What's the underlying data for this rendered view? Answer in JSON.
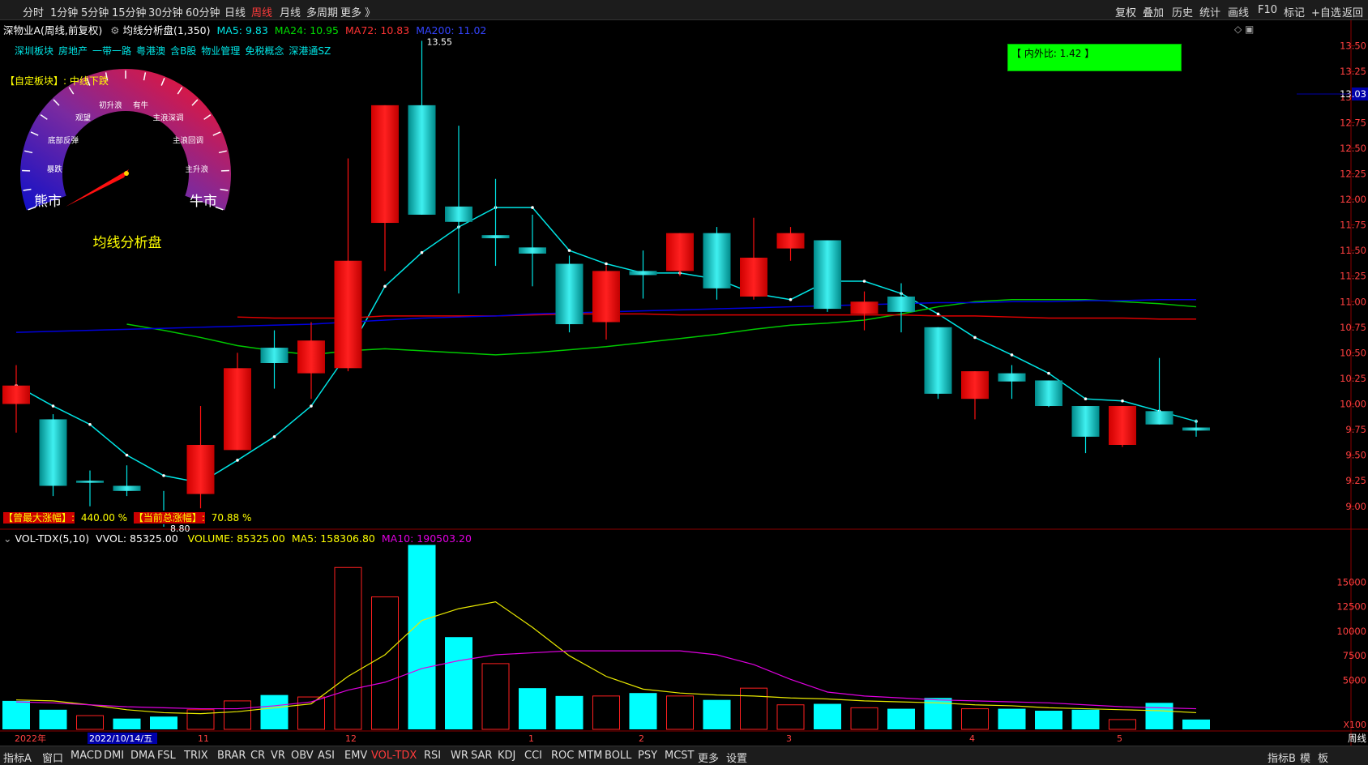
{
  "periods": [
    "分时",
    "1分钟",
    "5分钟",
    "15分钟",
    "30分钟",
    "60分钟",
    "日线",
    "周线",
    "月线",
    "多周期",
    "更多 》"
  ],
  "active_period": "周线",
  "tools": [
    "复权",
    "叠加",
    "历史",
    "统计",
    "画线",
    "F10",
    "标记",
    "+自选",
    "返回"
  ],
  "header": {
    "stock": "深物业A(周线,前复权)",
    "indicator": "均线分析盘(1,350)",
    "ma5": "MA5: 9.83",
    "ma24": "MA24: 10.95",
    "ma72": "MA72: 10.83",
    "ma200": "MA200: 11.02"
  },
  "sectors": [
    "深圳板块",
    "房地产",
    "一带一路",
    "粤港澳",
    "含B股",
    "物业管理",
    "免税概念",
    "深港通SZ"
  ],
  "custom_block": "【自定板块】: 中线下跌",
  "gauge": {
    "title": "均线分析盘",
    "labels": [
      "熊市",
      "暴跌",
      "底部反弹",
      "观望",
      "初升浪",
      "有牛",
      "主浪深调",
      "主浪回调",
      "主升浪",
      "牛市"
    ]
  },
  "inner_outer": "【 内外比: 1.42 】",
  "max_label": "13.55",
  "min_label": "8.80",
  "bottom_info": {
    "max_rise_label": "【曾最大涨幅】:",
    "max_rise_value": "440.00 %",
    "total_rise_label": "【当前总涨幅】:",
    "total_rise_value": "70.88 %"
  },
  "current_price": "13.03",
  "vol_header": {
    "name": "VOL-TDX(5,10)",
    "vvol": "VVOL: 85325.00",
    "volume": "VOLUME: 85325.00",
    "ma5": "MA5: 158306.80",
    "ma10": "MA10: 190503.20"
  },
  "price_axis": [
    "13.50",
    "13.25",
    "13.00",
    "12.75",
    "12.50",
    "12.25",
    "12.00",
    "11.75",
    "11.50",
    "11.25",
    "11.00",
    "10.75",
    "10.50",
    "10.25",
    "10.00",
    "9.75",
    "9.50",
    "9.25",
    "9.00"
  ],
  "vol_axis": [
    "15000",
    "12500",
    "10000",
    "7500",
    "5000"
  ],
  "vol_unit": "X100",
  "date_labels": [
    "2022年",
    "2022/10/14/五",
    "11",
    "12",
    "1",
    "2",
    "3",
    "4",
    "5"
  ],
  "period_corner": "周线",
  "indicators": [
    "指标A",
    "窗口",
    "MACD",
    "DMI",
    "DMA",
    "FSL",
    "TRIX",
    "BRAR",
    "CR",
    "VR",
    "OBV",
    "ASI",
    "EMV",
    "VOL-TDX",
    "RSI",
    "WR",
    "SAR",
    "KDJ",
    "CCI",
    "ROC",
    "MTM",
    "BOLL",
    "PSY",
    "MCST",
    "更多",
    "设置"
  ],
  "active_indicator": "VOL-TDX",
  "bottom_right": [
    "指标B",
    "模",
    "板"
  ],
  "colors": {
    "up": "#ff1010",
    "down": "#00e5e5",
    "ma5": "#00e5e5",
    "ma24": "#00c800",
    "ma72": "#e00000",
    "ma200": "#0000dd",
    "vol_ma5": "#e8e800",
    "vol_ma10": "#e000e0"
  },
  "chart_data": {
    "type": "candlestick",
    "title": "深物业A(周线,前复权)",
    "ylim": [
      8.8,
      13.6
    ],
    "candles": [
      {
        "o": 10.0,
        "c": 10.18,
        "h": 10.38,
        "l": 9.72
      },
      {
        "o": 9.85,
        "c": 9.2,
        "h": 9.9,
        "l": 9.1
      },
      {
        "o": 9.25,
        "c": 9.23,
        "h": 9.35,
        "l": 9.0
      },
      {
        "o": 9.2,
        "c": 9.15,
        "h": 9.4,
        "l": 9.1
      },
      {
        "o": 8.93,
        "c": 8.9,
        "h": 9.15,
        "l": 8.8
      },
      {
        "o": 9.12,
        "c": 9.6,
        "h": 9.98,
        "l": 8.98
      },
      {
        "o": 9.55,
        "c": 10.35,
        "h": 10.5,
        "l": 9.55
      },
      {
        "o": 10.55,
        "c": 10.4,
        "h": 10.72,
        "l": 10.15
      },
      {
        "o": 10.3,
        "c": 10.62,
        "h": 10.8,
        "l": 10.05
      },
      {
        "o": 10.35,
        "c": 11.4,
        "h": 12.4,
        "l": 10.32
      },
      {
        "o": 11.77,
        "c": 12.92,
        "h": 12.92,
        "l": 11.3
      },
      {
        "o": 12.92,
        "c": 11.85,
        "h": 13.55,
        "l": 11.85
      },
      {
        "o": 11.93,
        "c": 11.78,
        "h": 12.72,
        "l": 11.08
      },
      {
        "o": 11.65,
        "c": 11.62,
        "h": 12.2,
        "l": 11.35
      },
      {
        "o": 11.53,
        "c": 11.47,
        "h": 11.85,
        "l": 11.15
      },
      {
        "o": 11.37,
        "c": 10.78,
        "h": 11.45,
        "l": 10.7
      },
      {
        "o": 10.8,
        "c": 11.3,
        "h": 11.35,
        "l": 10.63
      },
      {
        "o": 11.3,
        "c": 11.26,
        "h": 11.5,
        "l": 11.03
      },
      {
        "o": 11.3,
        "c": 11.67,
        "h": 11.67,
        "l": 11.25
      },
      {
        "o": 11.67,
        "c": 11.13,
        "h": 11.73,
        "l": 11.02
      },
      {
        "o": 11.05,
        "c": 11.43,
        "h": 11.82,
        "l": 11.02
      },
      {
        "o": 11.52,
        "c": 11.67,
        "h": 11.73,
        "l": 11.4
      },
      {
        "o": 11.6,
        "c": 10.93,
        "h": 11.6,
        "l": 10.9
      },
      {
        "o": 10.88,
        "c": 11.0,
        "h": 11.1,
        "l": 10.72
      },
      {
        "o": 11.05,
        "c": 10.9,
        "h": 11.18,
        "l": 10.7
      },
      {
        "o": 10.75,
        "c": 10.1,
        "h": 10.75,
        "l": 10.05
      },
      {
        "o": 10.05,
        "c": 10.32,
        "h": 10.32,
        "l": 9.85
      },
      {
        "o": 10.3,
        "c": 10.22,
        "h": 10.38,
        "l": 10.05
      },
      {
        "o": 10.23,
        "c": 9.98,
        "h": 10.23,
        "l": 9.97
      },
      {
        "o": 9.98,
        "c": 9.68,
        "h": 9.98,
        "l": 9.52
      },
      {
        "o": 9.6,
        "c": 9.98,
        "h": 9.98,
        "l": 9.58
      },
      {
        "o": 9.93,
        "c": 9.8,
        "h": 10.45,
        "l": 9.8
      },
      {
        "o": 9.77,
        "c": 9.74,
        "h": 9.85,
        "l": 9.68
      }
    ],
    "series": [
      {
        "name": "MA5",
        "values": [
          10.18,
          9.98,
          9.8,
          9.5,
          9.3,
          9.23,
          9.45,
          9.68,
          9.98,
          10.5,
          11.15,
          11.48,
          11.73,
          11.92,
          11.92,
          11.5,
          11.37,
          11.28,
          11.28,
          11.22,
          11.08,
          11.02,
          11.2,
          11.2,
          11.08,
          10.88,
          10.65,
          10.48,
          10.3,
          10.05,
          10.03,
          9.93,
          9.83
        ]
      },
      {
        "name": "MA24",
        "values": [
          null,
          null,
          null,
          10.78,
          10.72,
          10.65,
          10.57,
          10.52,
          10.48,
          10.52,
          10.54,
          10.52,
          10.5,
          10.48,
          10.5,
          10.53,
          10.56,
          10.6,
          10.64,
          10.68,
          10.73,
          10.77,
          10.79,
          10.82,
          10.88,
          10.95,
          11.0,
          11.02,
          11.02,
          11.02,
          11.0,
          10.98,
          10.95
        ]
      },
      {
        "name": "MA72",
        "values": [
          null,
          null,
          null,
          null,
          null,
          null,
          10.85,
          10.84,
          10.84,
          10.84,
          10.86,
          10.86,
          10.86,
          10.86,
          10.87,
          10.88,
          10.88,
          10.88,
          10.87,
          10.87,
          10.87,
          10.87,
          10.87,
          10.87,
          10.87,
          10.86,
          10.86,
          10.85,
          10.84,
          10.84,
          10.84,
          10.83,
          10.83
        ]
      },
      {
        "name": "MA200",
        "values": [
          10.7,
          10.71,
          10.72,
          10.73,
          10.74,
          10.75,
          10.76,
          10.77,
          10.78,
          10.8,
          10.82,
          10.84,
          10.85,
          10.86,
          10.88,
          10.89,
          10.9,
          10.91,
          10.92,
          10.93,
          10.94,
          10.95,
          10.96,
          10.97,
          10.98,
          10.99,
          10.99,
          11.0,
          11.0,
          11.01,
          11.01,
          11.02,
          11.02
        ]
      }
    ],
    "volume": {
      "ylim": [
        0,
        19000
      ],
      "values": [
        2900,
        2000,
        1400,
        1100,
        1300,
        2000,
        2900,
        3500,
        3300,
        16500,
        13500,
        18800,
        9400,
        6700,
        4200,
        3400,
        3400,
        3700,
        3400,
        3000,
        4200,
        2500,
        2600,
        2200,
        2100,
        3200,
        2100,
        2100,
        1900,
        2000,
        1000,
        2700,
        1000
      ],
      "up": [
        false,
        false,
        true,
        false,
        false,
        true,
        true,
        false,
        true,
        true,
        true,
        false,
        false,
        true,
        false,
        false,
        true,
        false,
        true,
        false,
        true,
        true,
        false,
        true,
        false,
        false,
        true,
        false,
        false,
        false,
        true,
        false,
        false
      ],
      "ma5": [
        3000,
        2900,
        2500,
        2000,
        1700,
        1600,
        1800,
        2200,
        2600,
        5400,
        7600,
        11100,
        12300,
        13000,
        10400,
        7500,
        5400,
        4100,
        3700,
        3500,
        3400,
        3200,
        3100,
        2900,
        2800,
        2700,
        2500,
        2400,
        2200,
        2100,
        2000,
        1900,
        1700
      ],
      "ma10": [
        2800,
        2700,
        2500,
        2300,
        2200,
        2100,
        2100,
        2400,
        2800,
        4000,
        4800,
        6200,
        7000,
        7600,
        7800,
        8000,
        8000,
        8000,
        8000,
        7600,
        6600,
        5100,
        3800,
        3400,
        3200,
        3000,
        2900,
        2800,
        2700,
        2500,
        2300,
        2200,
        2100
      ]
    }
  }
}
